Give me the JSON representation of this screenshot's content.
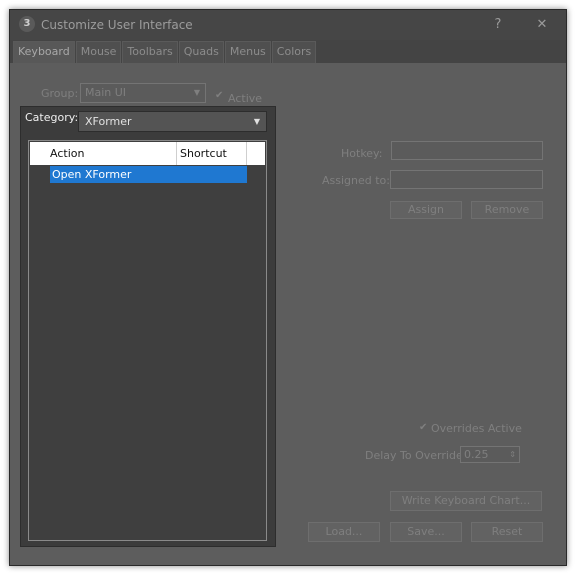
{
  "window": {
    "title": "Customize User Interface",
    "app_icon_text": "3",
    "help_label": "?",
    "close_label": "✕"
  },
  "tabs": [
    "Keyboard",
    "Mouse",
    "Toolbars",
    "Quads",
    "Menus",
    "Colors"
  ],
  "active_tab": "Keyboard",
  "group": {
    "label": "Group:",
    "value": "Main UI"
  },
  "active_check": {
    "label": "Active",
    "checked": true
  },
  "category": {
    "label": "Category:",
    "value": "XFormer"
  },
  "actions_table": {
    "columns": [
      "Action",
      "Shortcut"
    ],
    "rows": [
      {
        "action": "Open XFormer",
        "shortcut": "",
        "selected": true
      }
    ]
  },
  "hotkey": {
    "label": "Hotkey:",
    "value": ""
  },
  "assigned_to": {
    "label": "Assigned to:",
    "value": ""
  },
  "buttons": {
    "assign": "Assign",
    "remove": "Remove",
    "write_chart": "Write Keyboard Chart...",
    "load": "Load...",
    "save": "Save...",
    "reset": "Reset"
  },
  "overrides_active": {
    "label": "Overrides Active",
    "checked": true
  },
  "delay_override": {
    "label": "Delay To Override:",
    "value": "0.25"
  },
  "colors": {
    "selection": "#1f78d1",
    "background": "#5d5d5d",
    "popup": "#3c3c3c"
  }
}
